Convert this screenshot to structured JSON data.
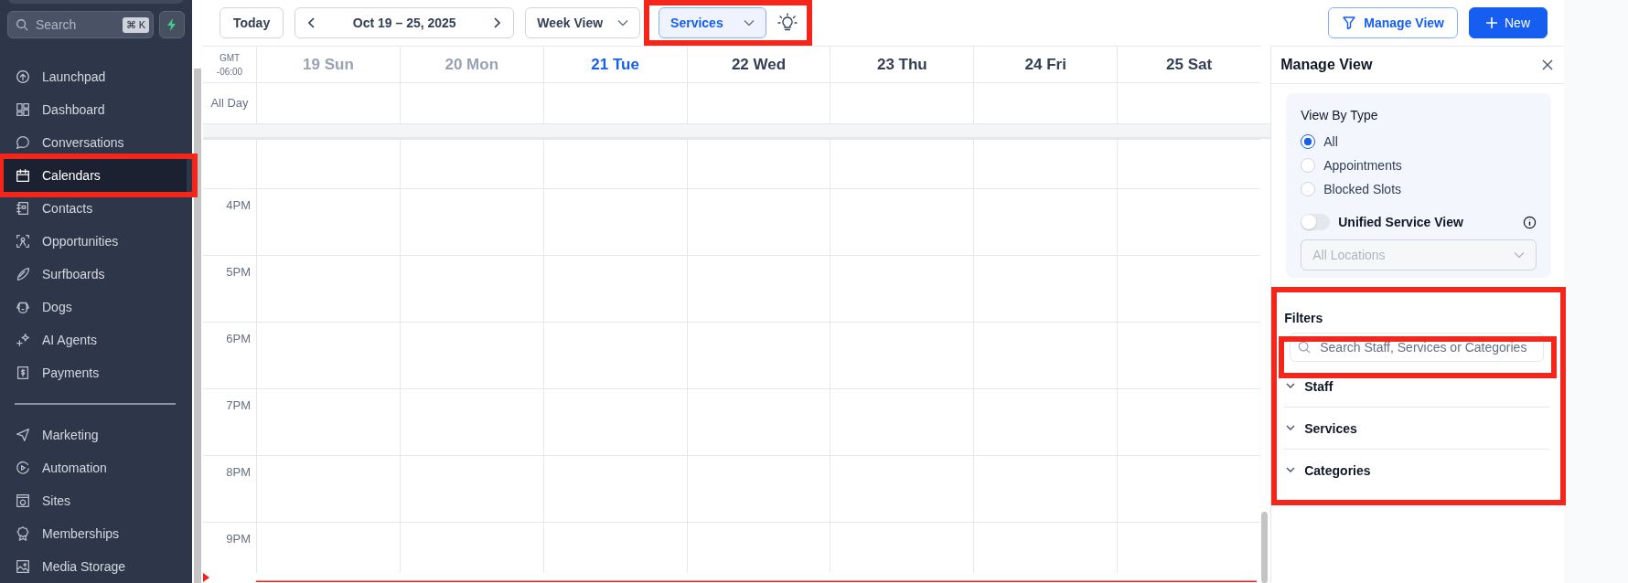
{
  "sidebar": {
    "search": {
      "placeholder": "Search",
      "shortcut": "⌘ K"
    },
    "items": [
      {
        "label": "Launchpad",
        "selected": false,
        "highlighted": false
      },
      {
        "label": "Dashboard",
        "selected": false,
        "highlighted": false
      },
      {
        "label": "Conversations",
        "selected": false,
        "highlighted": false
      },
      {
        "label": "Calendars",
        "selected": true,
        "highlighted": true
      },
      {
        "label": "Contacts",
        "selected": false,
        "highlighted": false
      },
      {
        "label": "Opportunities",
        "selected": false,
        "highlighted": false
      },
      {
        "label": "Surfboards",
        "selected": false,
        "highlighted": false
      },
      {
        "label": "Dogs",
        "selected": false,
        "highlighted": false
      },
      {
        "label": "AI Agents",
        "selected": false,
        "highlighted": false
      },
      {
        "label": "Payments",
        "selected": false,
        "highlighted": false
      }
    ],
    "secondary_items": [
      {
        "label": "Marketing",
        "selected": false
      },
      {
        "label": "Automation",
        "selected": false
      },
      {
        "label": "Sites",
        "selected": false
      },
      {
        "label": "Memberships",
        "selected": false
      },
      {
        "label": "Media Storage",
        "selected": false
      }
    ]
  },
  "toolbar": {
    "today": "Today",
    "date_range": "Oct 19 – 25, 2025",
    "view": "Week View",
    "calendar_filter": {
      "value": "Services",
      "highlighted": true
    },
    "manage_view": "Manage View",
    "new": "New"
  },
  "calendar": {
    "timezone_name": "GMT",
    "timezone_offset": "-06:00",
    "all_day_label": "All Day",
    "days": [
      {
        "label": "19 Sun",
        "past": true,
        "today": false
      },
      {
        "label": "20 Mon",
        "past": true,
        "today": false
      },
      {
        "label": "21 Tue",
        "past": false,
        "today": true
      },
      {
        "label": "22 Wed",
        "past": false,
        "today": false
      },
      {
        "label": "23 Thu",
        "past": false,
        "today": false
      },
      {
        "label": "24 Fri",
        "past": false,
        "today": false
      },
      {
        "label": "25 Sat",
        "past": false,
        "today": false
      }
    ],
    "hours": [
      "4PM",
      "5PM",
      "6PM",
      "7PM",
      "8PM",
      "9PM"
    ]
  },
  "manage_view": {
    "title": "Manage View",
    "view_by_type": {
      "label": "View By Type",
      "options": [
        {
          "label": "All",
          "selected": true
        },
        {
          "label": "Appointments",
          "selected": false
        },
        {
          "label": "Blocked Slots",
          "selected": false
        }
      ]
    },
    "unified_service_view": {
      "label": "Unified Service View",
      "on": false
    },
    "location": {
      "value": "All Locations",
      "disabled": true
    },
    "filters": {
      "label": "Filters",
      "highlighted": true,
      "search": {
        "placeholder": "Search Staff, Services or Categories",
        "highlighted": true
      },
      "groups": [
        {
          "label": "Staff"
        },
        {
          "label": "Services"
        },
        {
          "label": "Categories"
        }
      ]
    }
  }
}
